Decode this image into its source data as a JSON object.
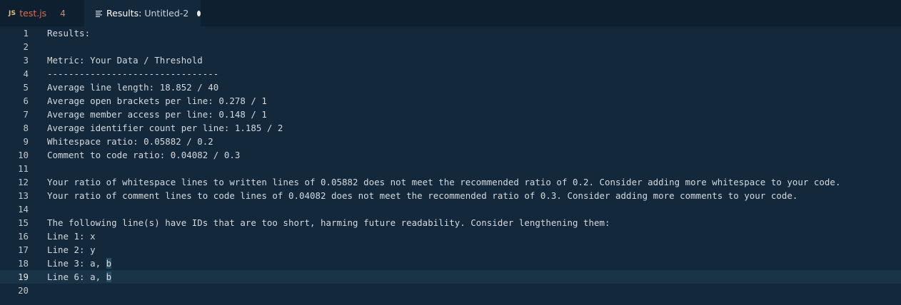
{
  "tabs": [
    {
      "label": "test.js",
      "icon": "JS",
      "badge": "4",
      "active": false
    },
    {
      "label": "Results:",
      "subtitle": "Untitled-2",
      "active": true,
      "dirty": true
    }
  ],
  "colors": {
    "background": "#13293b",
    "tabbar": "#0e2030",
    "text": "#d4d9dd",
    "error_tab_text": "#e06c4a",
    "js_icon": "#e5c07b"
  },
  "current_line": 19,
  "lines": [
    {
      "num": "1",
      "text": "Results:"
    },
    {
      "num": "2",
      "text": ""
    },
    {
      "num": "3",
      "text": "Metric: Your Data / Threshold"
    },
    {
      "num": "4",
      "text": "--------------------------------"
    },
    {
      "num": "5",
      "text": "Average line length: 18.852 / 40"
    },
    {
      "num": "6",
      "text": "Average open brackets per line: 0.278 / 1"
    },
    {
      "num": "7",
      "text": "Average member access per line: 0.148 / 1"
    },
    {
      "num": "8",
      "text": "Average identifier count per line: 1.185 / 2"
    },
    {
      "num": "9",
      "text": "Whitespace ratio: 0.05882 / 0.2"
    },
    {
      "num": "10",
      "text": "Comment to code ratio: 0.04082 / 0.3"
    },
    {
      "num": "11",
      "text": ""
    },
    {
      "num": "12",
      "text": "Your ratio of whitespace lines to written lines of 0.05882 does not meet the recommended ratio of 0.2. Consider adding more whitespace to your code."
    },
    {
      "num": "13",
      "text": "Your ratio of comment lines to code lines of 0.04082 does not meet the recommended ratio of 0.3. Consider adding more comments to your code."
    },
    {
      "num": "14",
      "text": ""
    },
    {
      "num": "15",
      "text": "The following line(s) have IDs that are too short, harming future readability. Consider lengthening them:"
    },
    {
      "num": "16",
      "text": "Line 1: x"
    },
    {
      "num": "17",
      "text": "Line 2: y"
    },
    {
      "num": "18",
      "prefix": "Line 3: a, ",
      "highlight": "b"
    },
    {
      "num": "19",
      "prefix": "Line 6: a, ",
      "highlight": "b"
    },
    {
      "num": "20",
      "text": ""
    }
  ]
}
